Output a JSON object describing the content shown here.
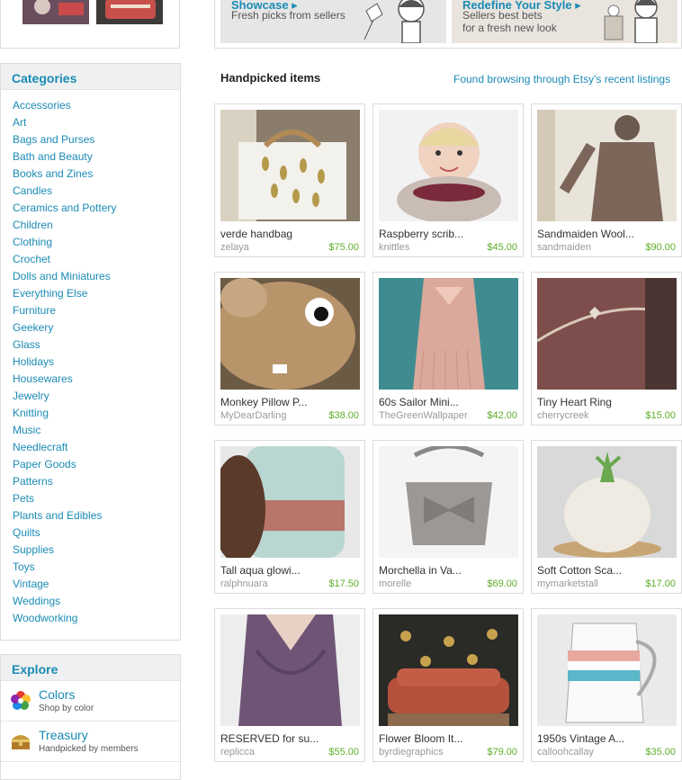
{
  "banners": [
    {
      "title": "Showcase ▸",
      "text": "Fresh picks from sellers"
    },
    {
      "title": "Redefine Your Style ▸",
      "text": "Sellers best bets\nfor a fresh new look"
    }
  ],
  "categories": {
    "heading": "Categories",
    "items": [
      "Accessories",
      "Art",
      "Bags and Purses",
      "Bath and Beauty",
      "Books and Zines",
      "Candles",
      "Ceramics and Pottery",
      "Children",
      "Clothing",
      "Crochet",
      "Dolls and Miniatures",
      "Everything Else",
      "Furniture",
      "Geekery",
      "Glass",
      "Holidays",
      "Housewares",
      "Jewelry",
      "Knitting",
      "Music",
      "Needlecraft",
      "Paper Goods",
      "Patterns",
      "Pets",
      "Plants and Edibles",
      "Quilts",
      "Supplies",
      "Toys",
      "Vintage",
      "Weddings",
      "Woodworking"
    ]
  },
  "explore": {
    "heading": "Explore",
    "items": [
      {
        "title": "Colors",
        "subtitle": "Shop by color",
        "icon": "color-wheel-icon"
      },
      {
        "title": "Treasury",
        "subtitle": "Handpicked by members",
        "icon": "treasure-chest-icon"
      }
    ]
  },
  "main": {
    "heading": "Handpicked items",
    "link": "Found browsing through Etsy's recent listings",
    "items": [
      {
        "title": "verde handbag",
        "seller": "zelaya",
        "price": "$75.00"
      },
      {
        "title": "Raspberry scrib...",
        "seller": "knittles",
        "price": "$45.00"
      },
      {
        "title": "Sandmaiden Wool...",
        "seller": "sandmaiden",
        "price": "$90.00"
      },
      {
        "title": "Monkey Pillow P...",
        "seller": "MyDearDarling",
        "price": "$38.00"
      },
      {
        "title": "60s Sailor Mini...",
        "seller": "TheGreenWallpaper",
        "price": "$42.00"
      },
      {
        "title": "Tiny Heart Ring",
        "seller": "cherrycreek",
        "price": "$15.00"
      },
      {
        "title": "Tall aqua glowi...",
        "seller": "ralphnuara",
        "price": "$17.50"
      },
      {
        "title": "Morchella in Va...",
        "seller": "morelle",
        "price": "$69.00"
      },
      {
        "title": "Soft Cotton Sca...",
        "seller": "mymarketstall",
        "price": "$17.00"
      },
      {
        "title": "RESERVED for su...",
        "seller": "replicca",
        "price": "$55.00"
      },
      {
        "title": "Flower Bloom It...",
        "seller": "byrdiegraphics",
        "price": "$79.00"
      },
      {
        "title": "1950s Vintage A...",
        "seller": "calloohcallay",
        "price": "$35.00"
      }
    ]
  }
}
